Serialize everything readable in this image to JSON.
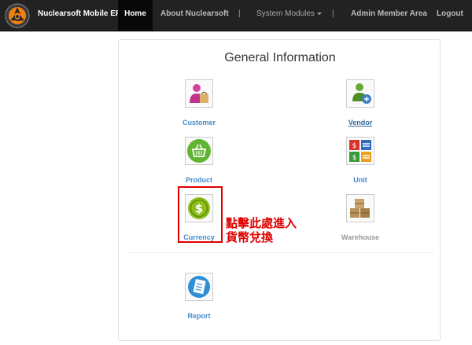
{
  "navbar": {
    "brand": "Nuclearsoft Mobile ERP",
    "items": {
      "home": "Home",
      "about": "About Nuclearsoft",
      "separator": "|",
      "modules": "System Modules",
      "admin": "Admin Member Area",
      "logout": "Logout"
    }
  },
  "panel": {
    "title": "General Information",
    "tiles": {
      "customer": {
        "label": "Customer",
        "icon": "customer-icon"
      },
      "vendor": {
        "label": "Vendor",
        "icon": "vendor-icon"
      },
      "product": {
        "label": "Product",
        "icon": "basket-icon"
      },
      "unit": {
        "label": "Unit",
        "icon": "unit-icon"
      },
      "currency": {
        "label": "Currency",
        "icon": "dollar-coin-icon"
      },
      "warehouse": {
        "label": "Warehouse",
        "icon": "boxes-icon"
      },
      "report": {
        "label": "Report",
        "icon": "report-icon"
      }
    },
    "annotation": {
      "line1": "點擊此處進入",
      "line2": "貨幣兌換"
    }
  },
  "colors": {
    "navbar_bg": "#222222",
    "link_blue": "#428bca",
    "annotation_red": "#e00000"
  }
}
